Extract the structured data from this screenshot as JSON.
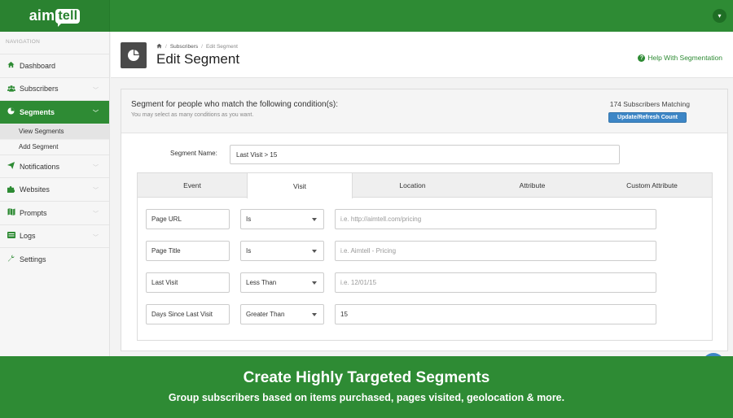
{
  "brand": {
    "logo_left": "aim",
    "logo_bubble": "tell",
    "primary_color": "#2e8b34",
    "accent_color": "#3d86c6"
  },
  "sidebar": {
    "heading": "NAVIGATION",
    "items": [
      {
        "label": "Dashboard",
        "icon": "home-icon"
      },
      {
        "label": "Subscribers",
        "icon": "users-icon"
      },
      {
        "label": "Segments",
        "icon": "pie-chart-icon"
      },
      {
        "label": "Notifications",
        "icon": "paper-plane-icon"
      },
      {
        "label": "Websites",
        "icon": "puzzle-icon"
      },
      {
        "label": "Prompts",
        "icon": "map-icon"
      },
      {
        "label": "Logs",
        "icon": "list-icon"
      },
      {
        "label": "Settings",
        "icon": "wrench-icon"
      }
    ],
    "segments_sub": [
      "View Segments",
      "Add Segment"
    ]
  },
  "header": {
    "breadcrumb": [
      "Subscribers",
      "Edit Segment"
    ],
    "title": "Edit Segment",
    "help": "Help With Segmentation"
  },
  "panel": {
    "title": "Segment for people who match the following condition(s):",
    "subtitle": "You may select as many conditions as you want.",
    "match_count": "174 Subscribers Matching",
    "refresh_button": "Update/Refresh Count",
    "name_label": "Segment Name:",
    "name_value": "Last Visit > 15"
  },
  "tabs": [
    "Event",
    "Visit",
    "Location",
    "Attribute",
    "Custom Attribute"
  ],
  "rows": [
    {
      "field": "Page URL",
      "operator": "Is",
      "value": "",
      "placeholder": "i.e. http://aimtell.com/pricing"
    },
    {
      "field": "Page Title",
      "operator": "Is",
      "value": "",
      "placeholder": "i.e. Aimtell - Pricing"
    },
    {
      "field": "Last Visit",
      "operator": "Less Than",
      "value": "",
      "placeholder": "i.e. 12/01/15"
    },
    {
      "field": "Days Since Last Visit",
      "operator": "Greater Than",
      "value": "15",
      "placeholder": ""
    }
  ],
  "banner": {
    "title": "Create Highly Targeted Segments",
    "subtitle": "Group subscribers based on items purchased, pages visited, geolocation & more."
  }
}
